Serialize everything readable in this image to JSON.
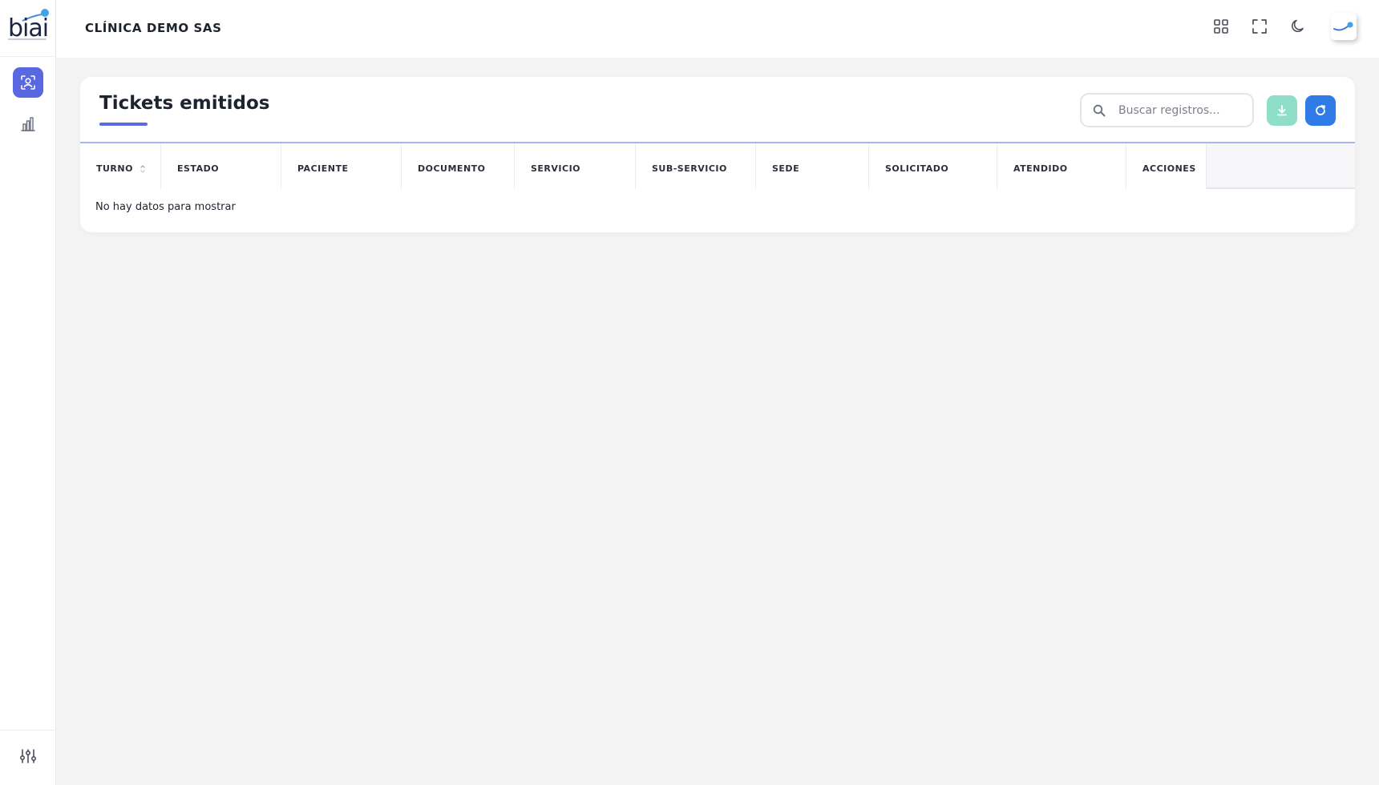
{
  "app": {
    "logo_text": "biai"
  },
  "header": {
    "org_name": "CLÍNICA DEMO SAS",
    "icons": [
      "grid-icon",
      "fullscreen-icon",
      "moon-icon"
    ],
    "avatar": "avatar"
  },
  "sidebar": {
    "items": [
      {
        "icon": "user-scan-icon",
        "active": true
      },
      {
        "icon": "bar-chart-icon",
        "active": false
      }
    ],
    "bottom": {
      "icon": "sliders-icon"
    }
  },
  "card": {
    "title": "Tickets emitidos",
    "search": {
      "placeholder": "Buscar registros...",
      "value": ""
    },
    "buttons": {
      "download": "download-icon",
      "refresh": "refresh-icon"
    }
  },
  "table": {
    "columns": [
      "TURNO",
      "ESTADO",
      "PACIENTE",
      "DOCUMENTO",
      "SERVICIO",
      "SUB-SERVICIO",
      "SEDE",
      "SOLICITADO",
      "ATENDIDO",
      "ACCIONES"
    ],
    "empty_message": "No hay datos para mostrar"
  },
  "colors": {
    "accent": "#5968e0",
    "refresh": "#2f7be8",
    "download": "#8fdec8",
    "background": "#f4f4f4"
  }
}
